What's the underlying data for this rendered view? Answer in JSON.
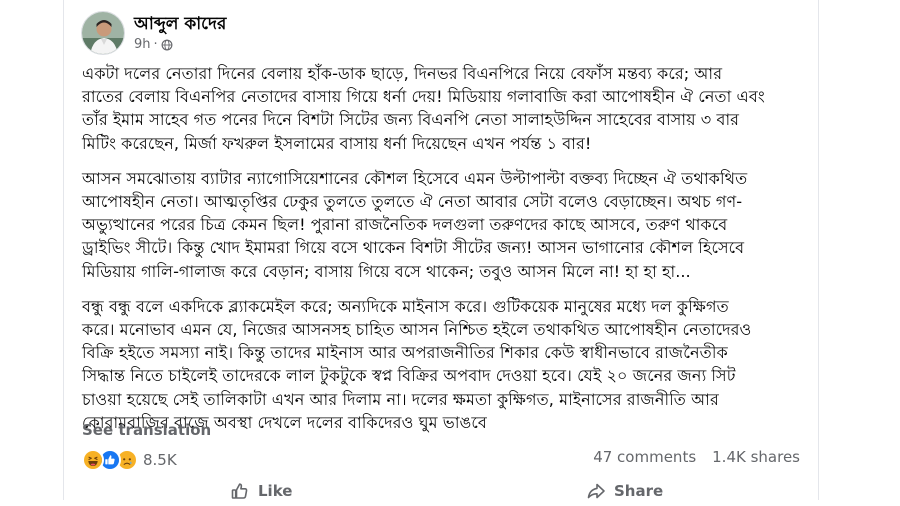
{
  "post": {
    "author": "আব্দুল কাদের",
    "time": "9h",
    "visibility_icon": "globe-icon",
    "paragraphs": [
      {
        "lines": [
          "একটা দলের নেতারা দিনের বেলায় হাঁক-ডাক ছাড়ে, দিনভর বিএনপিরে নিয়ে বেফাঁস মন্তব্য করে; আর",
          "রাতের বেলায় বিএনপির নেতাদের বাসায় গিয়ে ধর্না দেয়! মিডিয়ায় গলাবাজি করা আপোষহীন ঐ নেতা এবং",
          "তাঁর ইমাম সাহেব গত পনের দিনে বিশটা সিটের জন্য বিএনপি নেতা সালাহউদ্দিন সাহেবের বাসায় ৩ বার",
          "মিটিং করেছেন, মির্জা ফখরুল ইসলামের বাসায় ধর্না দিয়েছেন এখন পর্যন্ত  ১ বার!"
        ]
      },
      {
        "lines": [
          "আসন সমঝোতায় ব্যাটার ন্যাগোসিয়েশানের কৌশল হিসেবে এমন উল্টাপাল্টা বক্তব্য দিচ্ছেন ঐ তথাকথিত",
          "আপোষহীন নেতা। আত্মতৃপ্তির ঢেকুর তুলতে তুলতে ঐ নেতা আবার সেটা বলেও বেড়াচ্ছেন। অথচ গণ-",
          "অভ্যুত্থানের পরের চিত্র কেমন ছিল! পুরানা রাজনৈতিক দলগুলা তরুণদের কাছে আসবে, তরুণ থাকবে",
          "ড্রাইভিং সীটে। কিন্তু খোদ ইমামরা গিয়ে বসে থাকেন বিশটা সীটের জন্য! আসন ভাগানোর কৌশল হিসেবে",
          "মিডিয়ায় গালি-গালাজ করে বেড়ান; বাসায় গিয়ে বসে থাকেন; তবুও আসন মিলে না! হা হা হা..."
        ]
      },
      {
        "lines": [
          "বন্ধু বন্ধু বলে একদিকে ব্ল্যাকমেইল করে; অন্যদিকে মাইনাস করে। গুটিকয়েক মানুষের মধ্যে দল কুক্ষিগত",
          "করে। মনোভাব এমন যে, নিজের আসনসহ চাহিত আসন নিশ্চিত হইলে তথাকথিত আপোষহীন নেতাদেরও",
          "বিক্রি হইতে সমস্যা নাই। কিন্তু তাদের মাইনাস আর অপরাজনীতির শিকার কেউ স্বাধীনভাবে রাজনৈতীক",
          "সিদ্ধান্ত নিতে চাইলেই তাদেরকে লাল টুকটুকে স্বপ্ন বিক্রির অপবাদ দেওয়া হবে। যেই ২০ জনের জন্য সিট",
          "চাওয়া হয়েছে সেই তালিকাটা এখন আর দিলাম না। দলের ক্ষমতা কুক্ষিগত, মাইনাসের রাজনীতি আর",
          "কোরামবাজির বাজে অবস্থা দেখলে দলের বাকিদেরও ঘুম ভাঙবে"
        ]
      }
    ],
    "see_translation": "See translation"
  },
  "stats": {
    "reaction_icons": [
      "haha-icon",
      "like-icon",
      "sad-icon"
    ],
    "reaction_count": "8.5K",
    "comments": "47 comments",
    "shares": "1.4K shares"
  },
  "actions": {
    "like": "Like",
    "share": "Share"
  },
  "colors": {
    "text_primary": "#050505",
    "text_secondary": "#65676b",
    "like_blue": "#1877f2",
    "haha_yellow": "#f7b125",
    "divider": "#e4e6eb"
  }
}
